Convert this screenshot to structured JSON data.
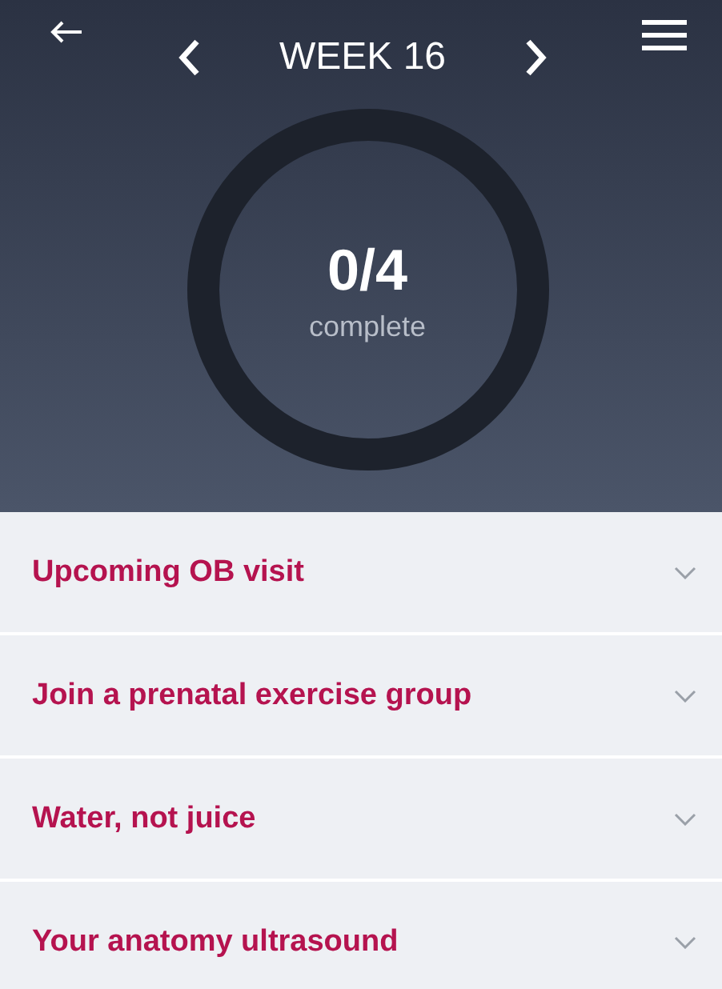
{
  "header": {
    "title": "WEEK 16",
    "count": "0/4",
    "count_label": "complete"
  },
  "items": [
    {
      "label": "Upcoming OB visit",
      "expanded": false
    },
    {
      "label": "Join a prenatal exercise group",
      "expanded": false
    },
    {
      "label": "Water, not juice",
      "expanded": false
    },
    {
      "label": "Your anatomy ultrasound",
      "expanded": false
    }
  ]
}
